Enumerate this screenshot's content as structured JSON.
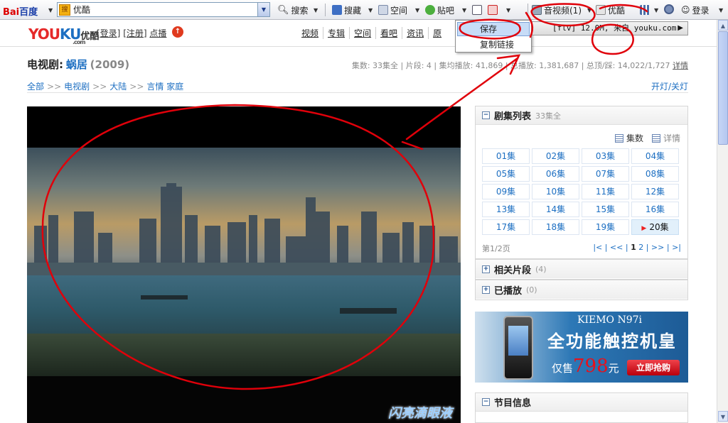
{
  "toolbar": {
    "logo_a": "Bai",
    "logo_b": "百度",
    "search_value": "优酷",
    "search_icon_text": "搜",
    "search_btn": "搜索",
    "bookmark_btn": "搜藏",
    "space_btn": "空间",
    "tieba_btn": "贴吧",
    "av_btn": "音视频(1)",
    "youku_btn": "优酷",
    "login_btn": "登录"
  },
  "context_menu": {
    "save": "保存",
    "copy_link": "复制链接",
    "media_item": "[flv] 12.0M, 来自 youku.com"
  },
  "header": {
    "logo_you": "YOU",
    "logo_ku": "KU",
    "logo_cn": "优酷",
    "logo_com": ".com",
    "login": "[登录]",
    "register": "[注册]",
    "upload": "点播",
    "nav": [
      "视频",
      "专辑",
      "空间",
      "看吧",
      "资讯",
      "原"
    ]
  },
  "show": {
    "type_label": "电视剧:",
    "name": "蜗居",
    "year": "(2009)",
    "stats": "集数: 33集全 | 片段: 4 | 集均播放: 41,869 | 总播放: 1,381,687 | 总顶/踩: 14,022/1,727",
    "detail_link": "详情"
  },
  "breadcrumb": {
    "items": [
      "全部",
      "电视剧",
      "大陆",
      "言情 家庭"
    ],
    "sep": ">>",
    "light_toggle": "开灯/关灯"
  },
  "player": {
    "watermark": "闪亮滴眼液"
  },
  "episode_panel": {
    "title": "剧集列表",
    "subtitle": "33集全",
    "view_grid": "集数",
    "view_detail": "详情",
    "episodes": [
      "01集",
      "02集",
      "03集",
      "04集",
      "05集",
      "06集",
      "07集",
      "08集",
      "09集",
      "10集",
      "11集",
      "12集",
      "13集",
      "14集",
      "15集",
      "16集",
      "17集",
      "18集",
      "19集",
      "20集"
    ],
    "current_index": 19,
    "page_info": "第1/2页",
    "pager_prefix": "|< | << |",
    "pager_page1": "1",
    "pager_page2": "2",
    "pager_suffix": "| >> | >|"
  },
  "related_panel": {
    "title": "相关片段",
    "count": "(4)"
  },
  "played_panel": {
    "title": "已播放",
    "count": "(0)"
  },
  "ad": {
    "model": "KIEMO N97i",
    "slogan": "全功能触控机皇",
    "price_prefix": "仅售",
    "price": "798",
    "price_unit": "元",
    "buy": "立即抢购"
  },
  "program_panel": {
    "title": "节目信息"
  },
  "colors": {
    "accent": "#1d6fc2",
    "annotation": "#e0000a",
    "brand_red": "#e52929"
  }
}
